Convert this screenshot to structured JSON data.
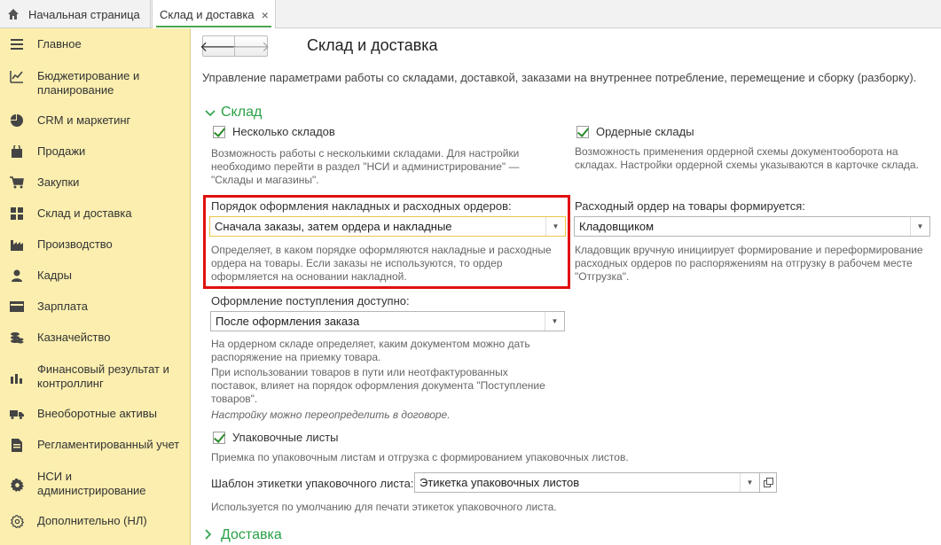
{
  "tabs": {
    "home": "Начальная страница",
    "active": "Склад и доставка",
    "close_symbol": "×"
  },
  "sidebar": {
    "items": [
      {
        "label": "Главное",
        "icon": "menu-icon"
      },
      {
        "label": "Бюджетирование и планирование",
        "icon": "budget-chart-icon"
      },
      {
        "label": "CRM и маркетинг",
        "icon": "pie-chart-icon"
      },
      {
        "label": "Продажи",
        "icon": "shopping-bag-icon"
      },
      {
        "label": "Закупки",
        "icon": "cart-icon"
      },
      {
        "label": "Склад и доставка",
        "icon": "warehouse-grid-icon"
      },
      {
        "label": "Производство",
        "icon": "factory-icon"
      },
      {
        "label": "Кадры",
        "icon": "person-icon"
      },
      {
        "label": "Зарплата",
        "icon": "wallet-icon"
      },
      {
        "label": "Казначейство",
        "icon": "coins-icon"
      },
      {
        "label": "Финансовый результат и контроллинг",
        "icon": "bar-chart-icon"
      },
      {
        "label": "Внеоборотные активы",
        "icon": "truck-icon"
      },
      {
        "label": "Регламентированный учет",
        "icon": "document-icon"
      },
      {
        "label": "НСИ и администрирование",
        "icon": "gear-icon"
      },
      {
        "label": "Дополнительно (НЛ)",
        "icon": "gear-outline-icon"
      }
    ]
  },
  "header": {
    "back_symbol": "🡐",
    "forward_symbol": "🡒",
    "title": "Склад и доставка",
    "description": "Управление параметрами работы со складами, доставкой, заказами на внутреннее потребление, перемещение и сборку (разборку)."
  },
  "sklad": {
    "group_title": "Склад",
    "multiple_warehouses": {
      "label": "Несколько складов",
      "checked": true,
      "note": "Возможность работы с несколькими складами. Для настройки необходимо перейти в раздел \"НСИ и администрирование\" — \"Склады и магазины\"."
    },
    "order_warehouses": {
      "label": "Ордерные склады",
      "checked": true,
      "note": "Возможность применения ордерной схемы документооборота на складах. Настройки ордерной схемы указываются в карточке склада."
    },
    "docs_order": {
      "label": "Порядок оформления накладных и расходных ордеров:",
      "value": "Сначала заказы, затем ордера и накладные",
      "note": "Определяет, в каком порядке оформляются накладные и расходные ордера на товары. Если заказы не используются, то ордер оформляется на основании накладной."
    },
    "expense_order": {
      "label": "Расходный ордер на товары формируется:",
      "value": "Кладовщиком",
      "note": "Кладовщик вручную инициирует формирование и переформирование расходных ордеров по распоряжениям на отгрузку в рабочем месте \"Отгрузка\"."
    },
    "receipt": {
      "label": "Оформление поступления доступно:",
      "value": "После оформления заказа",
      "note_line1": "На ордерном складе определяет, каким документом можно дать распоряжение на приемку товара.",
      "note_line2": "При использовании товаров в пути или неотфактурованных поставок, влияет на порядок оформления документа \"Поступление товаров\".",
      "note_italic": "Настройку можно переопределить в договоре."
    },
    "packing_lists": {
      "label": "Упаковочные листы",
      "checked": true,
      "note": "Приемка по упаковочным листам и отгрузка с формированием упаковочных листов."
    },
    "label_template": {
      "label": "Шаблон этикетки упаковочного листа:",
      "value": "Этикетка упаковочных листов",
      "note": "Используется по умолчанию для печати этикеток упаковочного листа."
    }
  },
  "delivery": {
    "group_title": "Доставка"
  },
  "colors": {
    "sidebar_bg": "#fbeeaf",
    "group_title": "#28a045",
    "highlight_border": "#e01010",
    "checkmark": "#2c8a2c"
  }
}
